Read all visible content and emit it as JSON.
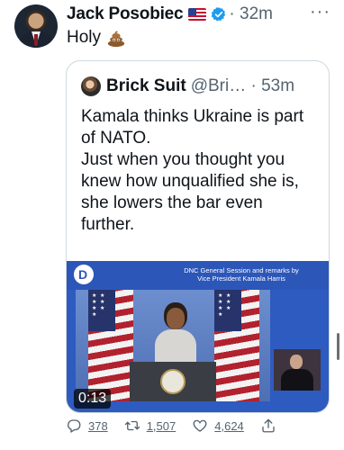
{
  "author": {
    "name": "Jack Posobiec",
    "time": "· 32m",
    "more": "···"
  },
  "tweet": {
    "text": "Holy"
  },
  "quote": {
    "name": "Brick Suit",
    "handle": "@Bri… · 53m",
    "lines": [
      "Kamala thinks Ukraine is part of NATO.",
      "Just when you thought you knew how unqualified she is, she lowers the bar even further."
    ],
    "media": {
      "caption_line1": "DNC General Session and remarks by",
      "caption_line2": "Vice President Kamala Harris",
      "duration": "0:13"
    }
  },
  "actions": {
    "reply_count": "378",
    "retweet_count": "1,507",
    "like_count": "4,624"
  },
  "icons": {
    "flag": "us-flag-icon",
    "verified": "verified-badge-icon",
    "poop": "pile-of-poo-emoji-icon"
  },
  "colors": {
    "text": "#0f1419",
    "secondary": "#536471",
    "verified": "#1d9bf0",
    "media_blue": "#2c57b8"
  }
}
